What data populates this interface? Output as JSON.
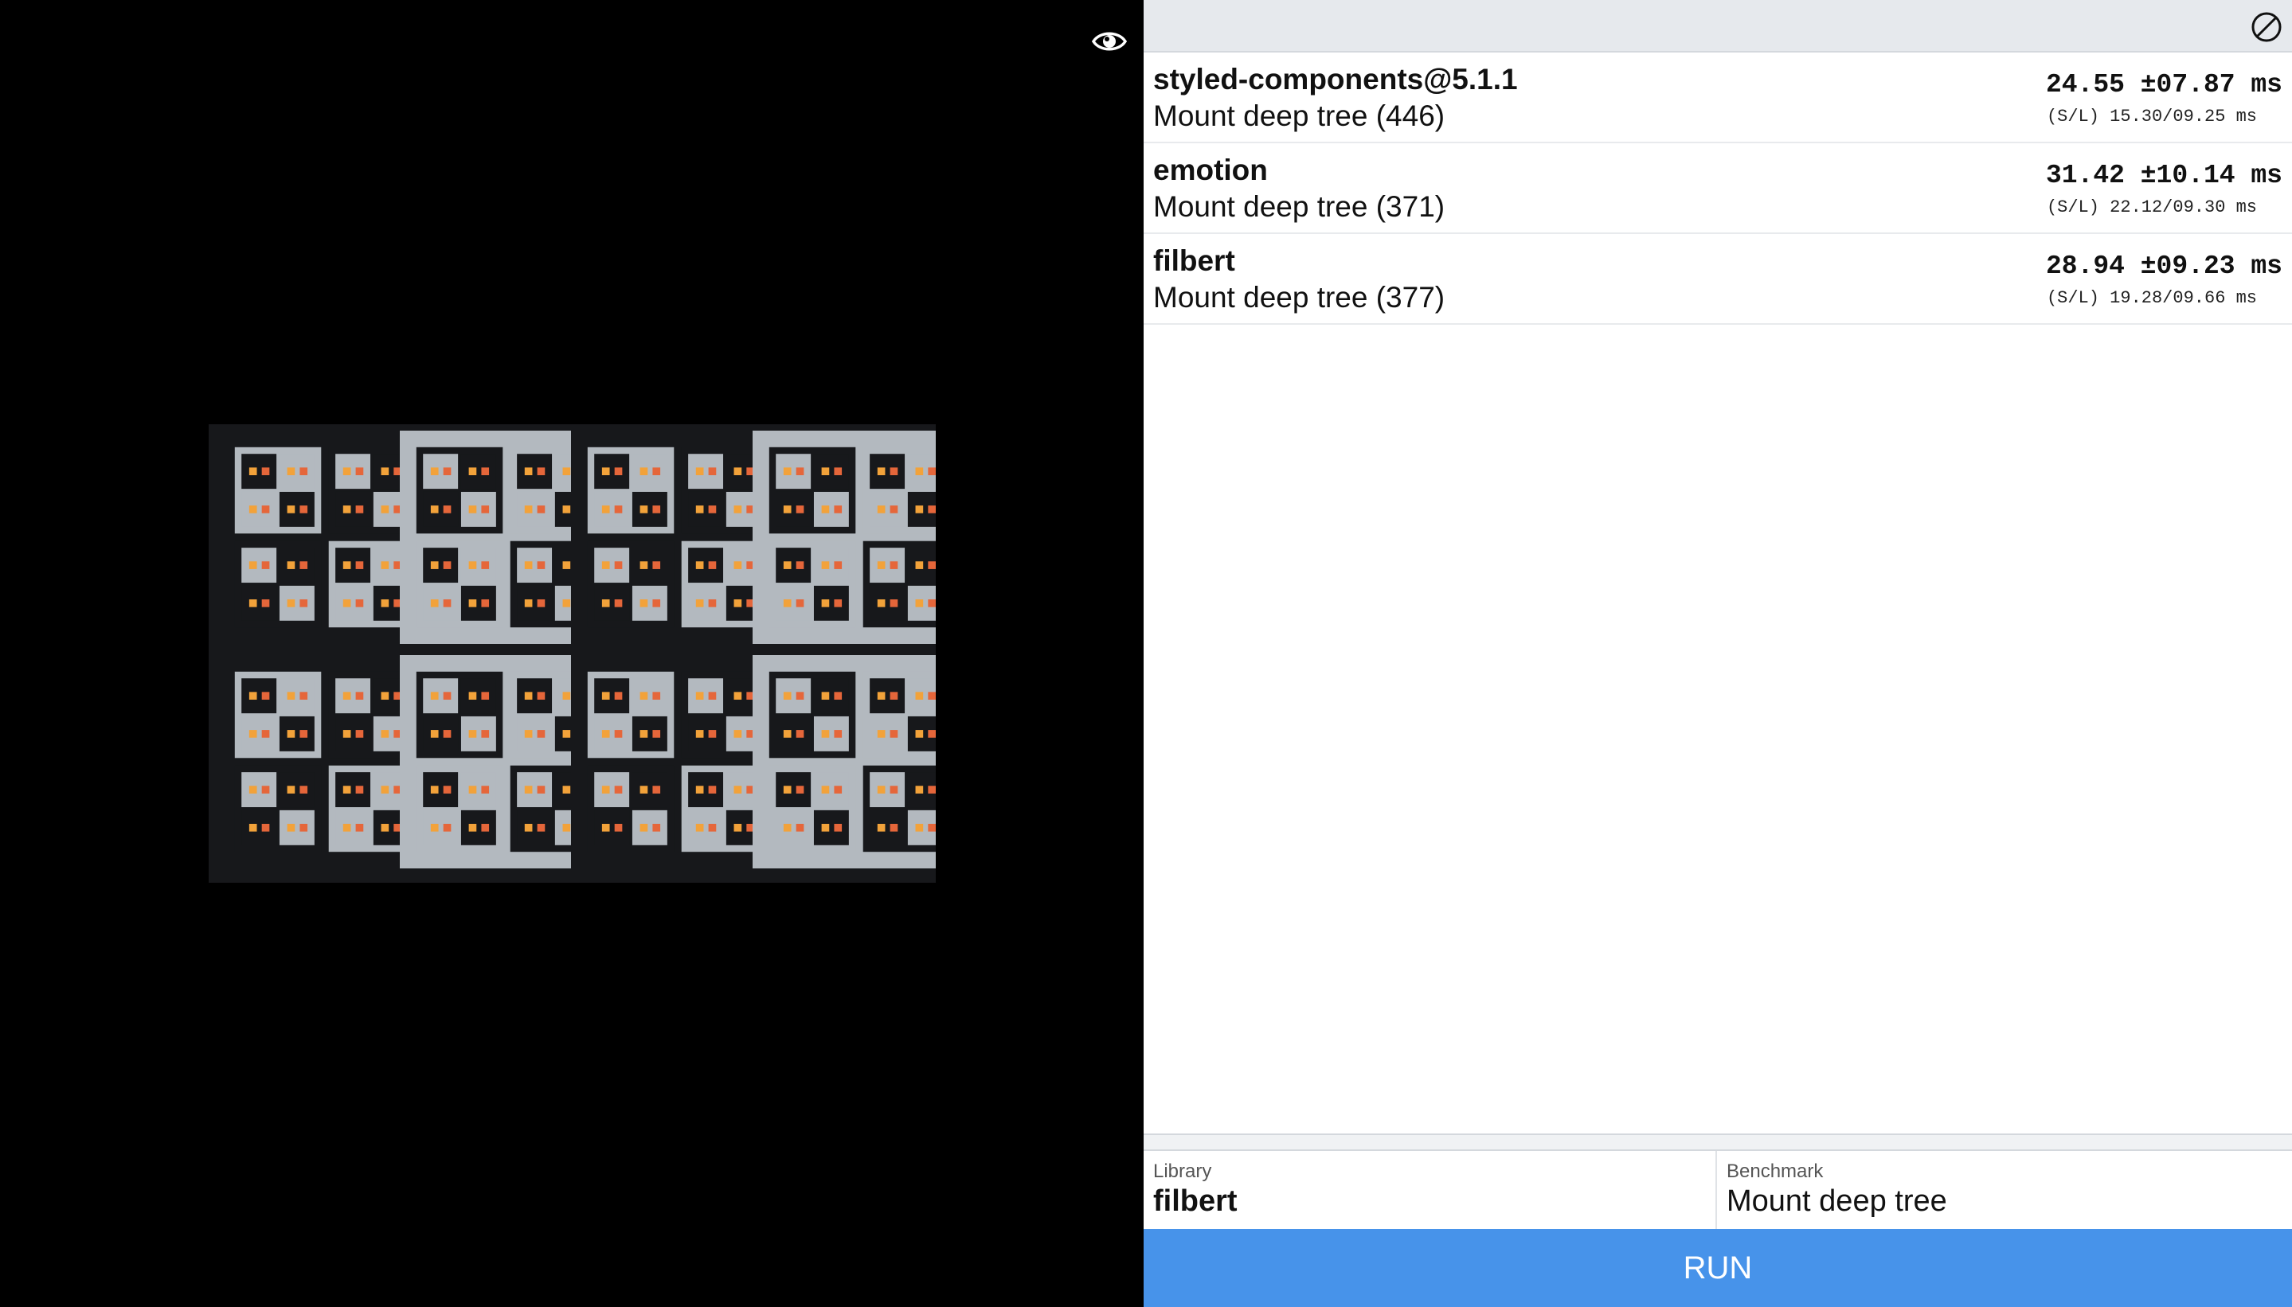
{
  "viewer": {
    "visibility_icon": "eye-icon"
  },
  "panel": {
    "clear_icon": "clear-results-icon",
    "results": [
      {
        "library": "styled-components@5.1.1",
        "benchmark": "Mount deep tree (446)",
        "mean": "24.55 ±07.87 ms",
        "sl": "(S/L) 15.30/09.25 ms"
      },
      {
        "library": "emotion",
        "benchmark": "Mount deep tree (371)",
        "mean": "31.42 ±10.14 ms",
        "sl": "(S/L) 22.12/09.30 ms"
      },
      {
        "library": "filbert",
        "benchmark": "Mount deep tree (377)",
        "mean": "28.94 ±09.23 ms",
        "sl": "(S/L) 19.28/09.66 ms"
      }
    ],
    "picker": {
      "library_label": "Library",
      "library_value": "filbert",
      "benchmark_label": "Benchmark",
      "benchmark_value": "Mount deep tree"
    },
    "run_label": "RUN"
  },
  "colors": {
    "panel_header": "#e6e9ed",
    "run_button": "#4793ea",
    "dark_box": "#17181b",
    "light_box": "#b3b9bf",
    "dot_orange": "#f2a23a",
    "dot_red": "#e5663a"
  }
}
